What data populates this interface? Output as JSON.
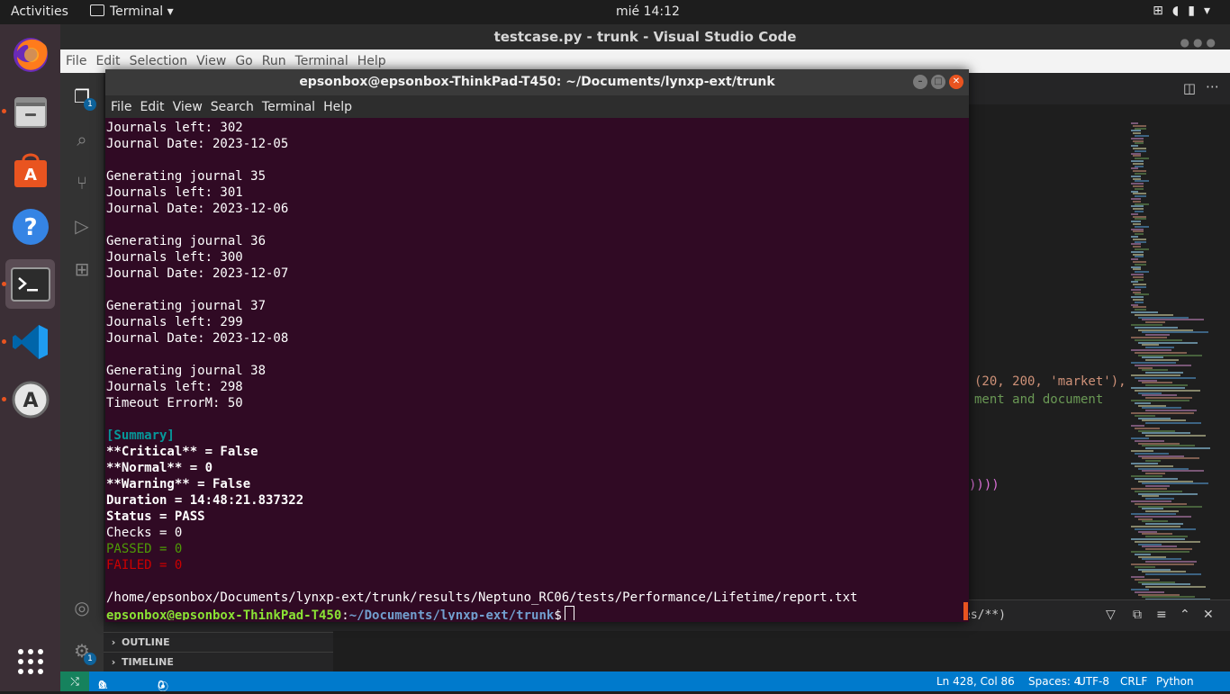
{
  "topbar": {
    "activities": "Activities",
    "app_name": "Terminal",
    "clock": "mié 14:12",
    "tray_icons": [
      "network-icon",
      "volume-icon",
      "battery-icon",
      "power-menu-icon"
    ]
  },
  "dock": {
    "items": [
      {
        "name": "Firefox",
        "icon": "firefox-icon",
        "running": false
      },
      {
        "name": "Files",
        "icon": "files-icon",
        "running": true
      },
      {
        "name": "Ubuntu Software",
        "icon": "software-icon",
        "running": false
      },
      {
        "name": "Help",
        "icon": "help-icon",
        "running": false
      },
      {
        "name": "Terminal",
        "icon": "terminal-icon",
        "running": true,
        "active": true
      },
      {
        "name": "Visual Studio Code",
        "icon": "vscode-icon",
        "running": true
      },
      {
        "name": "Software Updater",
        "icon": "updater-icon",
        "running": true
      }
    ],
    "show_apps_icon": "grid-icon"
  },
  "vscode": {
    "title": "testcase.py - trunk - Visual Studio Code",
    "menu": [
      "File",
      "Edit",
      "Selection",
      "View",
      "Go",
      "Run",
      "Terminal",
      "Help"
    ],
    "activity_badges": {
      "explorer": "1",
      "settings": "1"
    },
    "sections": {
      "outline": "OUTLINE",
      "timeline": "TIMELINE"
    },
    "code_fragments": [
      "(20, 200, 'market'),",
      "ment and document",
      "))))"
    ],
    "panel_filter": "es/**)",
    "status": {
      "errors": "0",
      "warnings": "0",
      "ports": "0",
      "position": "Ln 428, Col 86",
      "spaces": "Spaces: 4",
      "encoding": "UTF-8",
      "eol": "CRLF",
      "language": "Python"
    },
    "colors": {
      "statusbar": "#007acc",
      "remote": "#16825d"
    }
  },
  "terminal": {
    "title": "epsonbox@epsonbox-ThinkPad-T450: ~/Documents/lynxp-ext/trunk",
    "menu": [
      "File",
      "Edit",
      "View",
      "Search",
      "Terminal",
      "Help"
    ],
    "lines": [
      {
        "text": "Journals left: 302",
        "style": ""
      },
      {
        "text": "Journal Date: 2023-12-05",
        "style": ""
      },
      {
        "text": "",
        "style": ""
      },
      {
        "text": "Generating journal 35",
        "style": ""
      },
      {
        "text": "Journals left: 301",
        "style": ""
      },
      {
        "text": "Journal Date: 2023-12-06",
        "style": ""
      },
      {
        "text": "",
        "style": ""
      },
      {
        "text": "Generating journal 36",
        "style": ""
      },
      {
        "text": "Journals left: 300",
        "style": ""
      },
      {
        "text": "Journal Date: 2023-12-07",
        "style": ""
      },
      {
        "text": "",
        "style": ""
      },
      {
        "text": "Generating journal 37",
        "style": ""
      },
      {
        "text": "Journals left: 299",
        "style": ""
      },
      {
        "text": "Journal Date: 2023-12-08",
        "style": ""
      },
      {
        "text": "",
        "style": ""
      },
      {
        "text": "Generating journal 38",
        "style": ""
      },
      {
        "text": "Journals left: 298",
        "style": ""
      },
      {
        "text": "Timeout ErrorM: 50",
        "style": ""
      },
      {
        "text": "",
        "style": ""
      },
      {
        "text": "[Summary]",
        "style": "cyan"
      },
      {
        "text": "**Critical** = False",
        "style": "bold"
      },
      {
        "text": "**Normal** = 0",
        "style": "bold"
      },
      {
        "text": "**Warning** = False",
        "style": "bold"
      },
      {
        "text": "Duration = 14:48:21.837322",
        "style": "bold"
      },
      {
        "text": "Status = PASS",
        "style": "bold"
      },
      {
        "text": "Checks = 0",
        "style": ""
      },
      {
        "text": "PASSED = 0",
        "style": "green"
      },
      {
        "text": "FAILED = 0",
        "style": "red"
      },
      {
        "text": "",
        "style": ""
      },
      {
        "text": "/home/epsonbox/Documents/lynxp-ext/trunk/results/Neptuno_RC06/tests/Performance/Lifetime/report.txt",
        "style": ""
      }
    ],
    "prompt": {
      "user_host": "epsonbox@epsonbox-ThinkPad-T450",
      "sep": ":",
      "path": "~/Documents/lynxp-ext/trunk",
      "symbol": "$"
    },
    "colors": {
      "background": "#300a24",
      "prompt_user": "#8ae234",
      "prompt_path": "#729fcf"
    }
  }
}
